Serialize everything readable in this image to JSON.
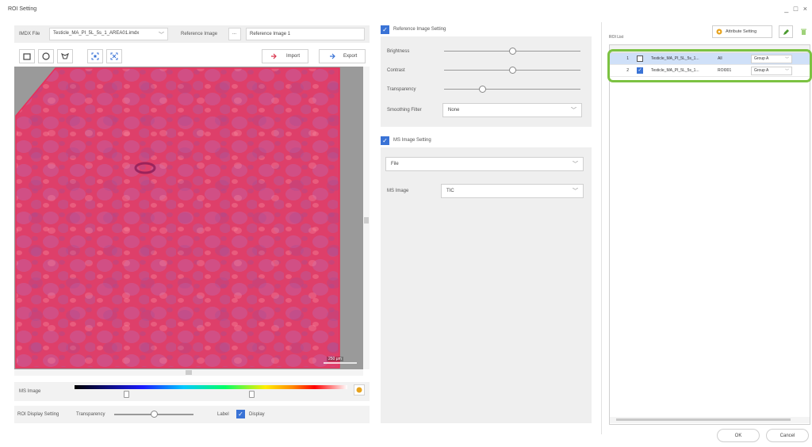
{
  "window": {
    "title": "ROI Setting",
    "controls": "_ □ ×"
  },
  "left": {
    "imdx_label": "IMDX File",
    "imdx_file": "Testicle_MA_PI_5L_5s_1_AREA01.imdx",
    "ref_label": "Reference Image",
    "ref_browse": "...",
    "ref_value": "Reference Image 1",
    "import_label": "Import",
    "export_label": "Export",
    "scale_bar": "250 μm",
    "ms_image_label": "MS Image",
    "roi_display_label": "ROI Display Setting",
    "transparency_label": "Transparency",
    "label_label": "Label",
    "display_label": "Display"
  },
  "reference": {
    "header": "Reference Image Setting",
    "brightness_label": "Brightness",
    "brightness_value": 0.6,
    "contrast_label": "Contrast",
    "contrast_value": 0.6,
    "transparency_label": "Transparency",
    "transparency_value": 0.28,
    "smoothing_label": "Smoothing Filter",
    "smoothing_value": "None"
  },
  "ms": {
    "header": "MS Image Setting",
    "source_value": "File",
    "ms_image_label": "MS Image",
    "ms_image_value": "TIC"
  },
  "right": {
    "roi_list_label": "ROI List",
    "attribute_button": "Attribute Setting",
    "rows": [
      {
        "num": "1",
        "checked": false,
        "file": "Testicle_MA_PI_5L_5s_1...",
        "roi": "All",
        "group": "Group A"
      },
      {
        "num": "2",
        "checked": true,
        "file": "Testicle_MA_PI_5L_5s_1...",
        "roi": "ROI001",
        "group": "Group A"
      }
    ],
    "ok": "OK",
    "cancel": "Cancel"
  },
  "colors": {
    "accent": "#3a73d6",
    "highlight": "#7cc242",
    "roi_overlay": "#e8305a"
  }
}
